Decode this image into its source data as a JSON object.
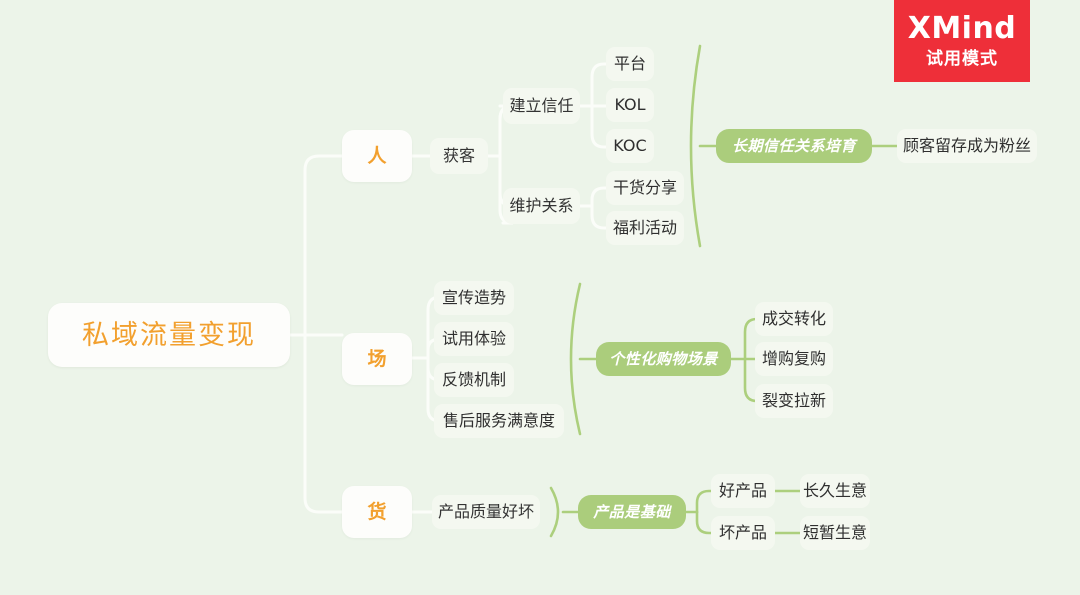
{
  "background_color": "#ecf4e9",
  "accent_color": "#f2a02e",
  "summary_color": "#abcd7c",
  "badge": {
    "title": "XMind",
    "subtitle": "试用模式",
    "color": "#ee2f39"
  },
  "central_topic": "私域流量变现",
  "branches": [
    {
      "label": "人",
      "child": "获客",
      "groups": [
        {
          "label": "建立信任",
          "items": [
            "平台",
            "KOL",
            "KOC"
          ]
        },
        {
          "label": "维护关系",
          "items": [
            "干货分享",
            "福利活动"
          ]
        }
      ],
      "summary": "长期信任关系培育",
      "summary_result": "顾客留存成为粉丝"
    },
    {
      "label": "场",
      "items": [
        "宣传造势",
        "试用体验",
        "反馈机制",
        "售后服务满意度"
      ],
      "summary": "个性化购物场景",
      "summary_children": [
        "成交转化",
        "增购复购",
        "裂变拉新"
      ]
    },
    {
      "label": "货",
      "child": "产品质量好坏",
      "summary": "产品是基础",
      "outcomes": [
        {
          "cause": "好产品",
          "effect": "长久生意"
        },
        {
          "cause": "坏产品",
          "effect": "短暂生意"
        }
      ]
    }
  ]
}
